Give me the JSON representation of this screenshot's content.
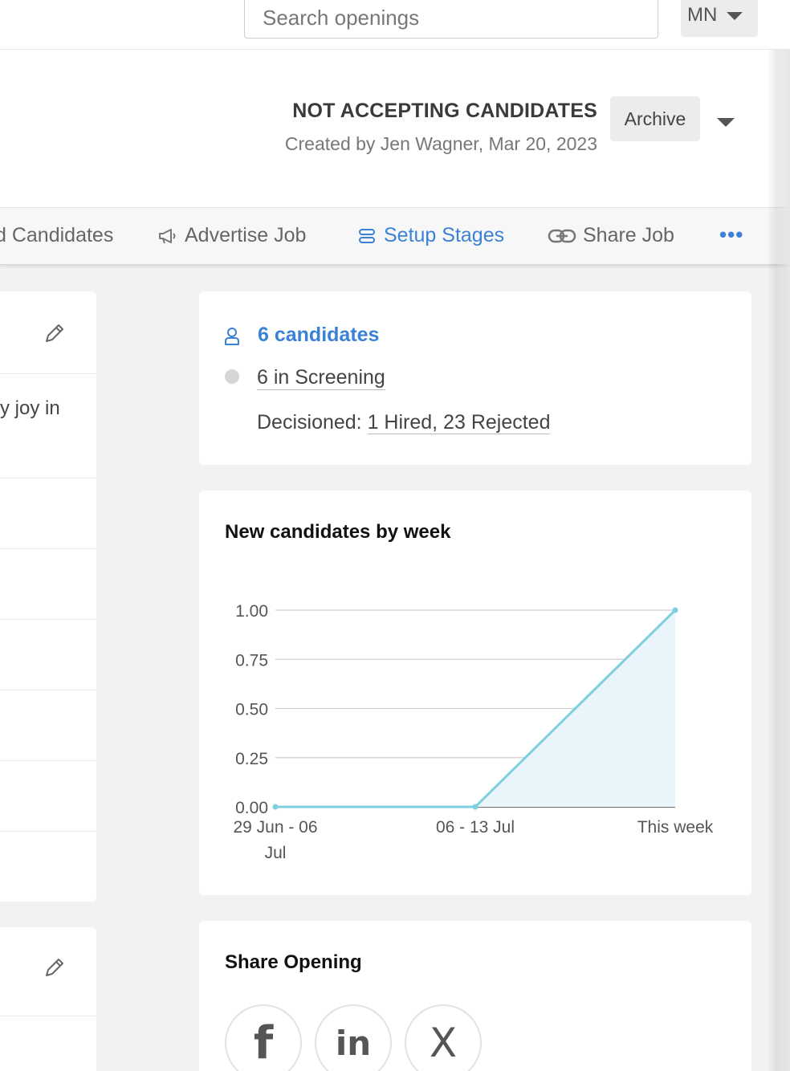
{
  "topbar": {
    "search_placeholder": "Search openings",
    "user_initials": "MN"
  },
  "job_header": {
    "status": "NOT ACCEPTING CANDIDATES",
    "created_by": "Created by Jen Wagner, Mar 20, 2023",
    "archive_label": "Archive"
  },
  "tabs": [
    {
      "label": "d Candidates",
      "icon": "add-person-icon",
      "active": false
    },
    {
      "label": "Advertise Job",
      "icon": "megaphone-icon",
      "active": false
    },
    {
      "label": "Setup Stages",
      "icon": "stages-icon",
      "active": true
    },
    {
      "label": "Share Job",
      "icon": "link-icon",
      "active": false
    }
  ],
  "more_label": "•••",
  "left_panel": {
    "fragment_text": "y joy in"
  },
  "candidates_card": {
    "count_label": "6 candidates",
    "screening_label": "6 in Screening",
    "decisioned_prefix": "Decisioned: ",
    "decisioned_link": "1 Hired, 23 Rejected"
  },
  "chart_card": {
    "title": "New candidates by week"
  },
  "chart_data": {
    "type": "area",
    "categories": [
      "29 Jun - 06 Jul",
      "06 - 13 Jul",
      "This week"
    ],
    "values": [
      0,
      0,
      1
    ],
    "ylim": [
      0,
      1
    ],
    "yticks": [
      "0.00",
      "0.25",
      "0.50",
      "0.75",
      "1.00"
    ],
    "grid": true,
    "line_color": "#7ecfe0",
    "fill_color": "#eaf5fb"
  },
  "share_card": {
    "title": "Share Opening",
    "buttons": [
      {
        "icon": "facebook-icon",
        "glyph": "f"
      },
      {
        "icon": "linkedin-icon",
        "glyph": "in"
      },
      {
        "icon": "x-icon",
        "glyph": "X"
      }
    ]
  },
  "colors": {
    "accent": "#3b82d6",
    "background": "#f2f2f2"
  }
}
